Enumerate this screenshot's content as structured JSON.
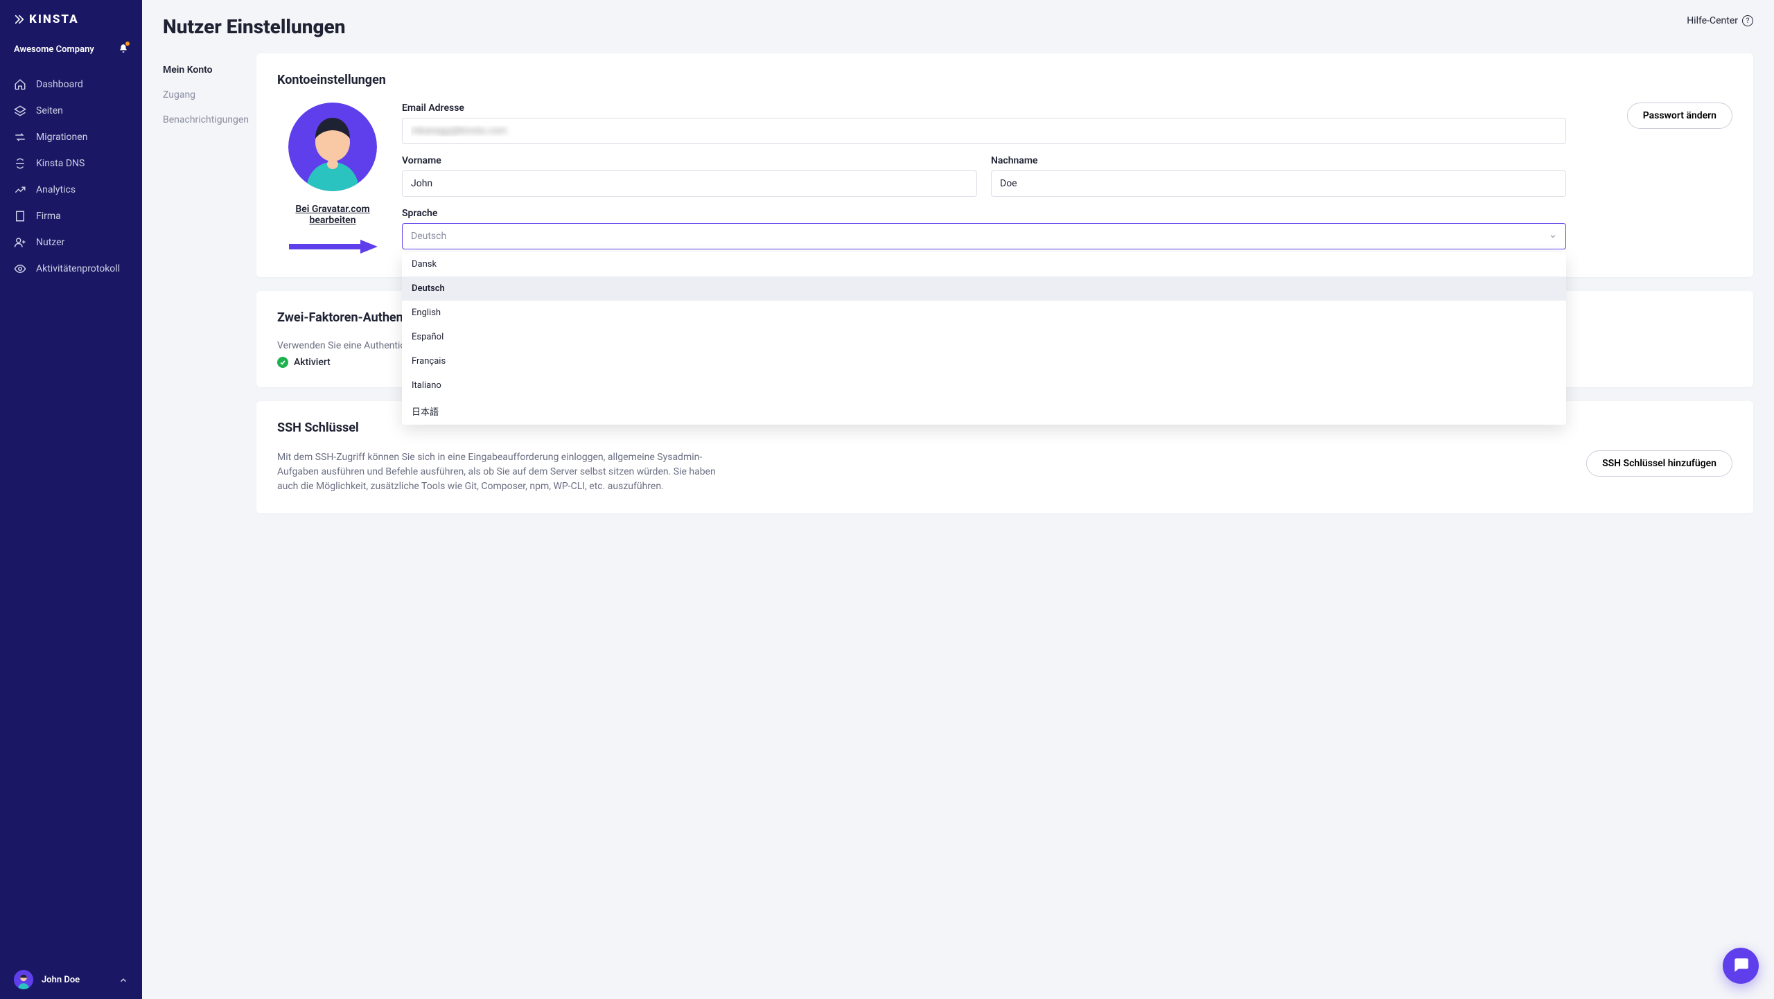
{
  "brand": "KINSTA",
  "company_name": "Awesome Company",
  "sidebar": {
    "items": [
      {
        "icon": "home",
        "label": "Dashboard"
      },
      {
        "icon": "layers",
        "label": "Seiten"
      },
      {
        "icon": "migrate",
        "label": "Migrationen"
      },
      {
        "icon": "dns",
        "label": "Kinsta DNS"
      },
      {
        "icon": "analytics",
        "label": "Analytics"
      },
      {
        "icon": "building",
        "label": "Firma"
      },
      {
        "icon": "users",
        "label": "Nutzer"
      },
      {
        "icon": "eye",
        "label": "Aktivitätenprotokoll"
      }
    ],
    "user_name": "John Doe"
  },
  "header": {
    "title": "Nutzer Einstellungen",
    "help": "Hilfe-Center"
  },
  "subnav": {
    "items": [
      {
        "label": "Mein Konto",
        "active": true
      },
      {
        "label": "Zugang",
        "active": false
      },
      {
        "label": "Benachrichtigungen",
        "active": false
      }
    ]
  },
  "account": {
    "card_title": "Kontoeinstellungen",
    "gravatar_link": "Bei Gravatar.com bearbeiten",
    "email_label": "Email Adresse",
    "email_value": "mkanagy@kinsta.com",
    "firstname_label": "Vorname",
    "firstname_value": "John",
    "lastname_label": "Nachname",
    "lastname_value": "Doe",
    "language_label": "Sprache",
    "language_value": "Deutsch",
    "change_password_btn": "Passwort ändern",
    "language_options": [
      "Dansk",
      "Deutsch",
      "English",
      "Español",
      "Français",
      "Italiano",
      "日本語"
    ],
    "language_selected": "Deutsch"
  },
  "twofa": {
    "card_title": "Zwei-Faktoren-Authent",
    "desc_prefix": "Verwenden Sie eine Authentic",
    "status": "Aktiviert"
  },
  "ssh": {
    "card_title": "SSH Schlüssel",
    "description": "Mit dem SSH-Zugriff können Sie sich in eine Eingabeaufforderung einloggen, allgemeine Sysadmin-Aufgaben ausführen und Befehle ausführen, als ob Sie auf dem Server selbst sitzen würden. Sie haben auch die Möglichkeit, zusätzliche Tools wie Git, Composer, npm, WP-CLI, etc. auszuführen.",
    "add_btn": "SSH Schlüssel hinzufügen"
  }
}
